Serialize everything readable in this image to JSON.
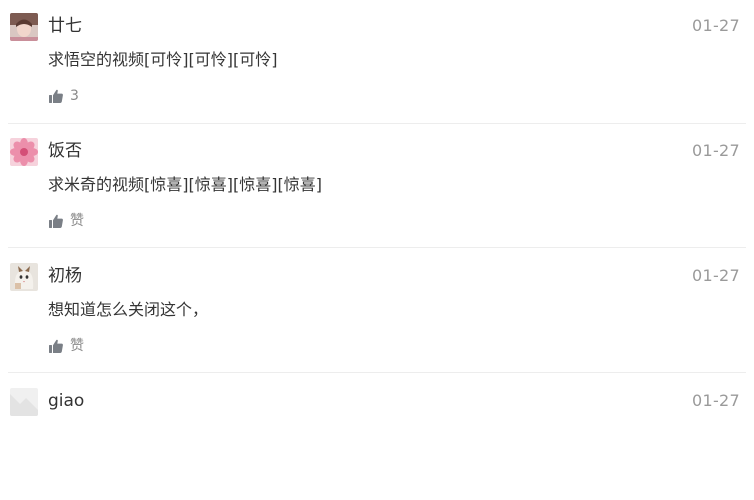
{
  "comments": [
    {
      "nickname": "廿七",
      "content": "求悟空的视频[可怜][可怜][可怜]",
      "date": "01-27",
      "like_icon": "thumbs-up-icon",
      "like_label": "3"
    },
    {
      "nickname": "饭否",
      "content": "求米奇的视频[惊喜][惊喜][惊喜][惊喜]",
      "date": "01-27",
      "like_icon": "thumbs-up-icon",
      "like_label": "赞"
    },
    {
      "nickname": "初杨",
      "content": "想知道怎么关闭这个，",
      "date": "01-27",
      "like_icon": "thumbs-up-icon",
      "like_label": "赞"
    },
    {
      "nickname": "giao",
      "content": "",
      "date": "01-27"
    }
  ],
  "colors": {
    "text": "#333333",
    "meta": "#9a9a9a",
    "like_icon": "#7a7f86",
    "divider": "#ededed"
  }
}
